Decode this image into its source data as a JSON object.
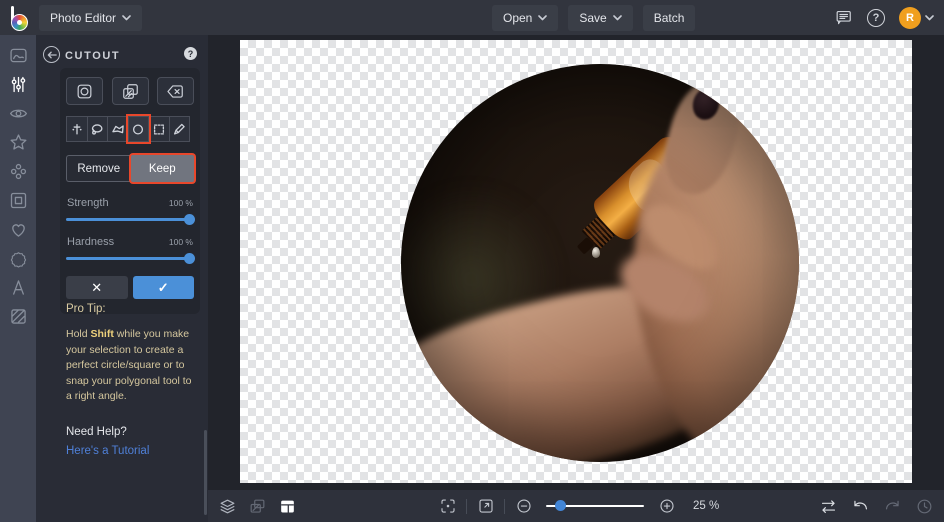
{
  "colors": {
    "accent_red": "#e8472b",
    "accent_blue": "#4b90d8",
    "link_blue": "#4f80d8",
    "avatar_orange": "#f09f1e",
    "protip_yellow": "#d5c79e"
  },
  "glyphs": {
    "question": "?",
    "close": "✕",
    "check": "✓"
  },
  "header": {
    "app_menu_label": "Photo Editor",
    "open_label": "Open",
    "save_label": "Save",
    "batch_label": "Batch",
    "avatar_initial": "R"
  },
  "sidebar_icons": [
    "photo-edit",
    "adjustments",
    "effects-eye",
    "artsy-star",
    "touchup-dots",
    "frames",
    "graphics-heart",
    "overlays-badge",
    "text",
    "textures"
  ],
  "cutout_panel": {
    "title": "CUTOUT",
    "primary_tools": [
      "shape-cutout",
      "invert-selection",
      "erase"
    ],
    "selection_tools": [
      "wand",
      "lasso",
      "polygon-lasso",
      "circle",
      "rectangle-marquee",
      "pen"
    ],
    "selected_tool": "circle",
    "remove_label": "Remove",
    "keep_label": "Keep",
    "active_mode": "Keep",
    "strength_label": "Strength",
    "strength_value": "100 %",
    "hardness_label": "Hardness",
    "hardness_value": "100 %",
    "protip_title": "Pro Tip:",
    "protip_pre": "Hold ",
    "protip_bold": "Shift",
    "protip_post": " while you make your selection to create a perfect circle/square or to snap your polygonal tool to a right angle.",
    "need_help": "Need Help?",
    "tutorial_link": "Here's a Tutorial"
  },
  "canvas": {
    "content_description": "Circular cutout selection over photo of a hand tilting an amber essential-oil dropper bottle above a wrist, on transparent checkerboard"
  },
  "bottom_bar": {
    "zoom_level": "25 %"
  }
}
